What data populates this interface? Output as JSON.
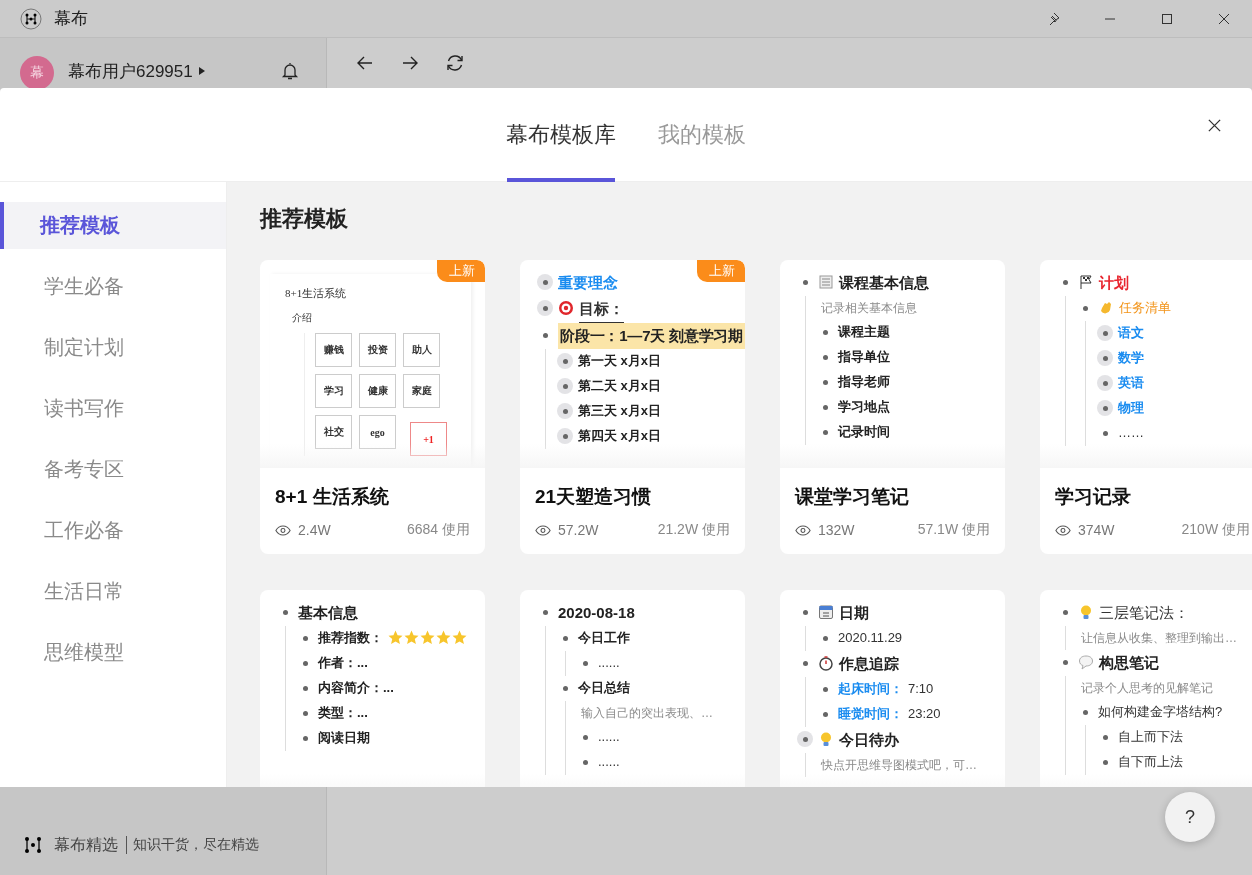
{
  "app": {
    "title": "幕布"
  },
  "user": {
    "avatar": "幕",
    "name": "幕布用户629951"
  },
  "footer": {
    "brand": "幕布精选",
    "slogan": "知识干货，尽在精选"
  },
  "help": {
    "label": "?"
  },
  "modal": {
    "tabs": [
      {
        "label": "幕布模板库",
        "selected": true
      },
      {
        "label": "我的模板",
        "selected": false
      }
    ],
    "categories": [
      {
        "label": "推荐模板",
        "selected": true
      },
      {
        "label": "学生必备",
        "selected": false
      },
      {
        "label": "制定计划",
        "selected": false
      },
      {
        "label": "读书写作",
        "selected": false
      },
      {
        "label": "备考专区",
        "selected": false
      },
      {
        "label": "工作必备",
        "selected": false
      },
      {
        "label": "生活日常",
        "selected": false
      },
      {
        "label": "思维模型",
        "selected": false
      }
    ],
    "section_title": "推荐模板",
    "cards": [
      {
        "title": "8+1 生活系统",
        "views": "2.4W",
        "uses": "6684 使用",
        "badge": "上新",
        "preview": {
          "kind": "sheet",
          "title": "8+1生活系统",
          "item": "介绍",
          "cells": [
            {
              "label": "赚钱",
              "accent": false
            },
            {
              "label": "投资",
              "accent": false
            },
            {
              "label": "助人",
              "accent": false
            },
            {
              "label": "学习",
              "accent": false
            },
            {
              "label": "健康",
              "accent": false
            },
            {
              "label": "家庭",
              "accent": false
            },
            {
              "label": "社交",
              "accent": false
            },
            {
              "label": "ego",
              "accent": false
            },
            {
              "label": "+1",
              "accent": true
            }
          ]
        }
      },
      {
        "title": "21天塑造习惯",
        "views": "57.2W",
        "uses": "21.2W 使用",
        "badge": "上新",
        "preview": {
          "kind": "outline",
          "items": [
            {
              "text": "重要理念",
              "kind": "concept",
              "collapsed": true
            },
            {
              "text": "目标：",
              "kind": "goal",
              "collapsed": true
            },
            {
              "text": "阶段一：1—7天 刻意学习期",
              "kind": "phase",
              "collapsed": false,
              "children": [
                {
                  "text": "第一天 x月x日",
                  "kind": "field",
                  "collapsed": true
                },
                {
                  "text": "第二天 x月x日",
                  "kind": "field",
                  "collapsed": true
                },
                {
                  "text": "第三天 x月x日",
                  "kind": "field",
                  "collapsed": true
                },
                {
                  "text": "第四天 x月x日",
                  "kind": "field",
                  "collapsed": true
                }
              ]
            }
          ]
        }
      },
      {
        "title": "课堂学习笔记",
        "views": "132W",
        "uses": "57.1W 使用",
        "preview": {
          "kind": "outline",
          "items": [
            {
              "text": "课程基本信息",
              "kind": "header",
              "collapsed": false,
              "note": "记录相关基本信息",
              "children": [
                {
                  "text": "课程主题",
                  "kind": "field",
                  "collapsed": false
                },
                {
                  "text": "指导单位",
                  "kind": "field",
                  "collapsed": false
                },
                {
                  "text": "指导老师",
                  "kind": "field",
                  "collapsed": false
                },
                {
                  "text": "学习地点",
                  "kind": "field",
                  "collapsed": false
                },
                {
                  "text": "记录时间",
                  "kind": "field",
                  "collapsed": false
                }
              ]
            }
          ]
        }
      },
      {
        "title": "学习记录",
        "views": "374W",
        "uses": "210W 使用",
        "preview": {
          "kind": "outline",
          "items": [
            {
              "text": "计划",
              "kind": "plan",
              "collapsed": false,
              "children": [
                {
                  "text": "任务清单",
                  "kind": "tasks",
                  "collapsed": false,
                  "children": [
                    {
                      "text": "语文",
                      "kind": "subject",
                      "collapsed": true
                    },
                    {
                      "text": "数学",
                      "kind": "subject",
                      "collapsed": true
                    },
                    {
                      "text": "英语",
                      "kind": "subject",
                      "collapsed": true
                    },
                    {
                      "text": "物理",
                      "kind": "subject",
                      "collapsed": true
                    },
                    {
                      "text": "……",
                      "kind": "plain",
                      "collapsed": false
                    }
                  ]
                }
              ]
            }
          ]
        }
      },
      {
        "preview": {
          "kind": "outline",
          "items": [
            {
              "text": "基本信息",
              "kind": "title",
              "collapsed": false,
              "children": [
                {
                  "text": "推荐指数：",
                  "kind": "field",
                  "stars": 5,
                  "collapsed": false
                },
                {
                  "text": "作者：...",
                  "kind": "field",
                  "collapsed": false
                },
                {
                  "text": "内容简介：...",
                  "kind": "field",
                  "collapsed": false
                },
                {
                  "text": "类型：...",
                  "kind": "field",
                  "collapsed": false
                },
                {
                  "text": "阅读日期",
                  "kind": "field",
                  "collapsed": false
                }
              ]
            }
          ]
        }
      },
      {
        "preview": {
          "kind": "outline",
          "items": [
            {
              "text": "2020-08-18",
              "kind": "field",
              "collapsed": false,
              "children": [
                {
                  "text": "今日工作",
                  "kind": "field",
                  "collapsed": false,
                  "children": [
                    {
                      "text": "......",
                      "kind": "plain",
                      "collapsed": false
                    }
                  ]
                },
                {
                  "text": "今日总结",
                  "kind": "field",
                  "collapsed": false,
                  "note": "输入自己的突出表现、…",
                  "children": [
                    {
                      "text": "......",
                      "kind": "plain",
                      "collapsed": false
                    },
                    {
                      "text": "......",
                      "kind": "plain",
                      "collapsed": false
                    }
                  ]
                }
              ]
            }
          ]
        }
      },
      {
        "preview": {
          "kind": "outline",
          "items": [
            {
              "text": "日期",
              "kind": "date",
              "collapsed": false,
              "children": [
                {
                  "text": "2020.11.29",
                  "kind": "plain",
                  "collapsed": false
                }
              ]
            },
            {
              "text": "作息追踪",
              "kind": "routine",
              "collapsed": false,
              "children": [
                {
                  "label": "起床时间：",
                  "text": "7:10",
                  "kind": "plain",
                  "collapsed": false
                },
                {
                  "label": "睡觉时间：",
                  "text": "23:20",
                  "kind": "plain",
                  "collapsed": false
                }
              ]
            },
            {
              "text": "今日待办",
              "kind": "todo",
              "collapsed": true,
              "note": "快点开思维导图模式吧，可…"
            }
          ]
        }
      },
      {
        "preview": {
          "kind": "outline",
          "items": [
            {
              "text": "三层笔记法：",
              "kind": "tip",
              "collapsed": false,
              "note": "让信息从收集、整理到输出…"
            },
            {
              "text": "构思笔记",
              "kind": "idea",
              "collapsed": false,
              "note": "记录个人思考的见解笔记",
              "children": [
                {
                  "text": "如何构建金字塔结构?",
                  "kind": "plain",
                  "collapsed": false,
                  "children": [
                    {
                      "text": "自上而下法",
                      "kind": "plain",
                      "collapsed": false
                    },
                    {
                      "text": "自下而上法",
                      "kind": "plain",
                      "collapsed": false
                    }
                  ]
                }
              ]
            }
          ]
        }
      }
    ]
  }
}
